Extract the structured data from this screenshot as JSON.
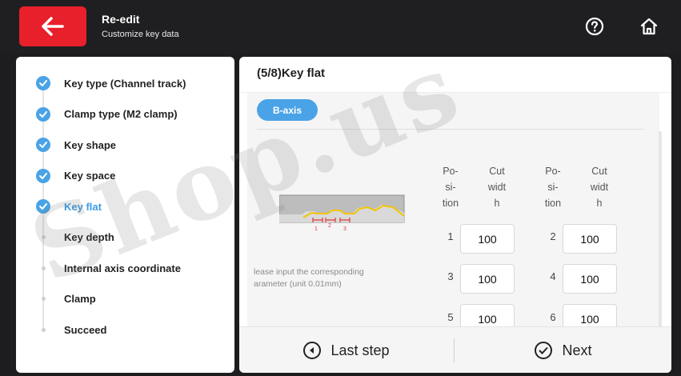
{
  "header": {
    "title": "Re-edit",
    "subtitle": "Customize key data",
    "icons": {
      "back": "arrow-left-icon",
      "help": "help-circle-icon",
      "home": "home-icon"
    },
    "accent": "#e8202b"
  },
  "steps": [
    {
      "label": "Key type (Channel track)",
      "state": "done"
    },
    {
      "label": "Clamp type (M2 clamp)",
      "state": "done"
    },
    {
      "label": "Key shape",
      "state": "done"
    },
    {
      "label": "Key space",
      "state": "done"
    },
    {
      "label": "Key flat",
      "state": "active"
    },
    {
      "label": "Key depth",
      "state": "pending"
    },
    {
      "label": "Internal axis coordinate",
      "state": "pending"
    },
    {
      "label": "Clamp",
      "state": "pending"
    },
    {
      "label": "Succeed",
      "state": "pending"
    }
  ],
  "main": {
    "section_title": "(5/8)Key flat",
    "axis_tab": "B-axis",
    "hint_line1": "lease input the corresponding",
    "hint_line2": "arameter (unit 0.01mm)",
    "col_headers": {
      "pos_a": [
        "Po-",
        "si-",
        "tion"
      ],
      "cut_a": [
        "Cut",
        "widt",
        "h"
      ],
      "pos_b": [
        "Po-",
        "si-",
        "tion"
      ],
      "cut_b": [
        "Cut",
        "widt",
        "h"
      ]
    },
    "rows": [
      {
        "p1": "1",
        "v1": "100",
        "p2": "2",
        "v2": "100"
      },
      {
        "p1": "3",
        "v1": "100",
        "p2": "4",
        "v2": "100"
      },
      {
        "p1": "5",
        "v1": "100",
        "p2": "6",
        "v2": "100"
      }
    ],
    "key_markers": [
      "1",
      "2",
      "3"
    ]
  },
  "footer": {
    "prev_label": "Last step",
    "next_label": "Next"
  },
  "watermark": "Shop.us",
  "colors": {
    "check": "#4aa3e6",
    "active_text": "#3d9be3"
  }
}
